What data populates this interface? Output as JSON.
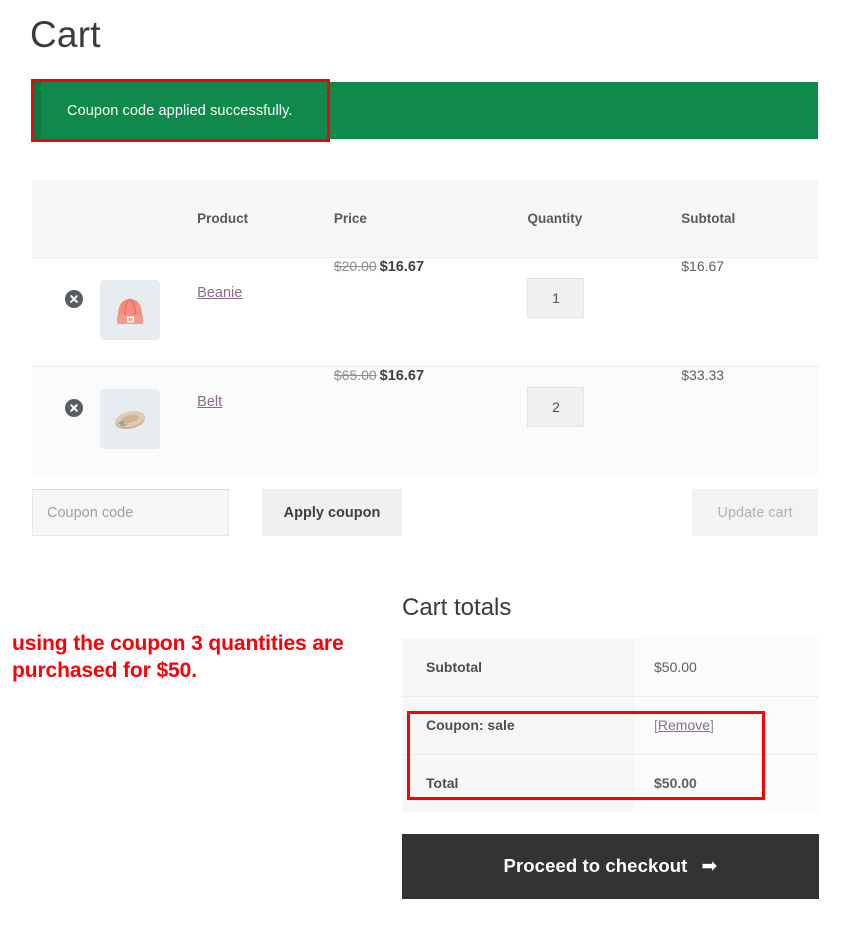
{
  "page": {
    "title": "Cart"
  },
  "notice": {
    "message": "Coupon code applied successfully.",
    "background_color": "#0f8a4c"
  },
  "cart_table": {
    "columns": [
      "",
      "",
      "Product",
      "Price",
      "Quantity",
      "Subtotal"
    ],
    "headers": {
      "product": "Product",
      "price": "Price",
      "quantity": "Quantity",
      "subtotal": "Subtotal"
    },
    "rows": [
      {
        "remove_icon": "remove-circle-x-icon",
        "thumbnail": "beanie-thumbnail",
        "name": "Beanie",
        "price_original": "$20.00",
        "price_sale": "$16.67",
        "quantity": "1",
        "subtotal": "$16.67"
      },
      {
        "remove_icon": "remove-circle-x-icon",
        "thumbnail": "belt-thumbnail",
        "name": "Belt",
        "price_original": "$65.00",
        "price_sale": "$16.67",
        "quantity": "2",
        "subtotal": "$33.33"
      }
    ]
  },
  "coupon": {
    "placeholder": "Coupon code",
    "value": "",
    "apply_label": "Apply coupon",
    "update_label": "Update cart"
  },
  "annotation": {
    "text": "using the coupon 3 quantities are purchased for $50.",
    "color": "#fb0007"
  },
  "totals": {
    "title": "Cart totals",
    "rows": [
      {
        "label": "Subtotal",
        "value": "$50.00"
      },
      {
        "label": "Coupon: sale",
        "value": "[Remove]",
        "link_text": "Remove"
      },
      {
        "label": "Total",
        "value": "$50.00"
      }
    ],
    "subtotal_label": "Subtotal",
    "subtotal_value": "$50.00",
    "coupon_label": "Coupon: sale",
    "coupon_remove_open": "[",
    "coupon_remove_text": "Remove",
    "coupon_remove_close": "]",
    "total_label": "Total",
    "total_value": "$50.00"
  },
  "checkout": {
    "label": "Proceed to checkout",
    "arrow": "➡"
  }
}
